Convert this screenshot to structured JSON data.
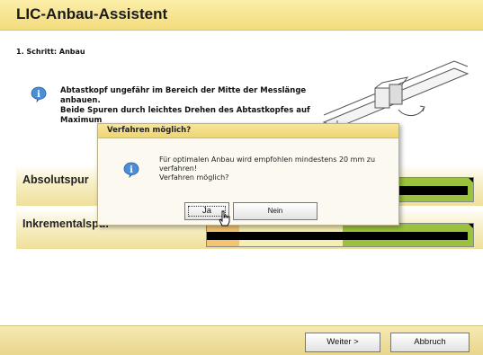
{
  "window": {
    "title": "LIC-Anbau-Assistent"
  },
  "step": {
    "label": "1. Schritt: Anbau"
  },
  "instructions": {
    "line1": "Abtastkopf ungefähr im Bereich der Mitte der Messlänge",
    "line2": "anbauen.",
    "line3": "Beide Spuren durch leichtes Drehen des Abtastkopfes auf",
    "line4": "Maximum"
  },
  "tracks": [
    {
      "label": "Absolutspur",
      "segments": [
        {
          "color": "#f4eeb0",
          "fraction": 0.505
        },
        {
          "color": "#9ac23c",
          "fraction": 0.495
        }
      ],
      "signal_fraction": 0.98
    },
    {
      "label": "Inkrementalspur",
      "segments": [
        {
          "color": "#f7c46e",
          "fraction": 0.12
        },
        {
          "color": "#f4eeb0",
          "fraction": 0.39
        },
        {
          "color": "#9ac23c",
          "fraction": 0.49
        }
      ],
      "signal_fraction": 0.98
    }
  ],
  "footer": {
    "weiter_label": "Weiter >",
    "abbruch_label": "Abbruch"
  },
  "dialog": {
    "title": "Verfahren möglich?",
    "message_line1": "Für optimalen Anbau wird empfohlen mindestens 20 mm zu",
    "message_line2": "verfahren!",
    "message_line3": "Verfahren möglich?",
    "yes_label": "Ja",
    "no_label": "Nein"
  },
  "icons": {
    "info": "info-icon",
    "cursor": "hand-pointer-icon"
  },
  "colors": {
    "accent": "#f3dc7e",
    "info_blue": "#3a7fd0"
  }
}
